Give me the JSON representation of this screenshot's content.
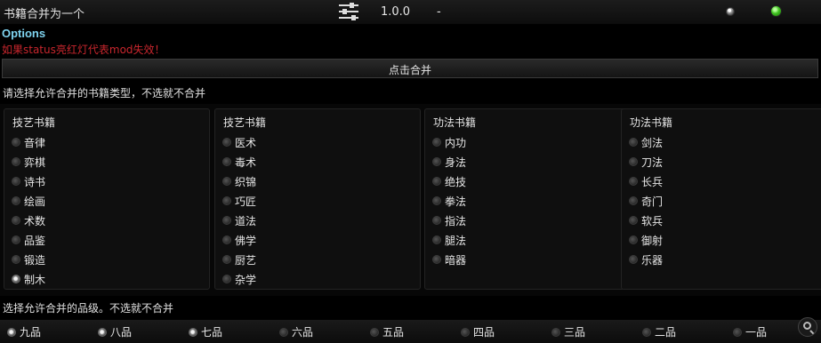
{
  "header": {
    "mod_title": "书籍合并为一个",
    "version": "1.0.0",
    "dash": "-",
    "settings_icon": "sliders-icon",
    "status_indicator_color": "#3ec11f"
  },
  "options": {
    "title": "Options",
    "warning": "如果status亮红灯代表mod失效！",
    "warning_color": "#c8262d",
    "title_color": "#7fd4f0"
  },
  "merge_button": {
    "label": "点击合并"
  },
  "book_types": {
    "prompt": "请选择允许合并的书籍类型，不选就不合并",
    "columns": [
      {
        "header": "技艺书籍",
        "items": [
          {
            "label": "音律",
            "checked": false
          },
          {
            "label": "弈棋",
            "checked": false
          },
          {
            "label": "诗书",
            "checked": false
          },
          {
            "label": "绘画",
            "checked": false
          },
          {
            "label": "术数",
            "checked": false
          },
          {
            "label": "品鉴",
            "checked": false
          },
          {
            "label": "锻造",
            "checked": false
          },
          {
            "label": "制木",
            "checked": true
          }
        ]
      },
      {
        "header": "技艺书籍",
        "items": [
          {
            "label": "医术",
            "checked": false
          },
          {
            "label": "毒术",
            "checked": false
          },
          {
            "label": "织锦",
            "checked": false
          },
          {
            "label": "巧匠",
            "checked": false
          },
          {
            "label": "道法",
            "checked": false
          },
          {
            "label": "佛学",
            "checked": false
          },
          {
            "label": "厨艺",
            "checked": false
          },
          {
            "label": "杂学",
            "checked": false
          }
        ]
      },
      {
        "header": "功法书籍",
        "items": [
          {
            "label": "内功",
            "checked": false
          },
          {
            "label": "身法",
            "checked": false
          },
          {
            "label": "绝技",
            "checked": false
          },
          {
            "label": "拳法",
            "checked": false
          },
          {
            "label": "指法",
            "checked": false
          },
          {
            "label": "腿法",
            "checked": false
          },
          {
            "label": "暗器",
            "checked": false
          }
        ]
      },
      {
        "header": "功法书籍",
        "items": [
          {
            "label": "剑法",
            "checked": false
          },
          {
            "label": "刀法",
            "checked": false
          },
          {
            "label": "长兵",
            "checked": false
          },
          {
            "label": "奇门",
            "checked": false
          },
          {
            "label": "软兵",
            "checked": false
          },
          {
            "label": "御射",
            "checked": false
          },
          {
            "label": "乐器",
            "checked": false
          }
        ]
      }
    ]
  },
  "grades": {
    "prompt": "选择允许合并的品级。不选就不合并",
    "items": [
      {
        "label": "九品",
        "checked": true
      },
      {
        "label": "八品",
        "checked": true
      },
      {
        "label": "七品",
        "checked": true
      },
      {
        "label": "六品",
        "checked": false
      },
      {
        "label": "五品",
        "checked": false
      },
      {
        "label": "四品",
        "checked": false
      },
      {
        "label": "三品",
        "checked": false
      },
      {
        "label": "二品",
        "checked": false
      },
      {
        "label": "一品",
        "checked": false
      }
    ]
  }
}
